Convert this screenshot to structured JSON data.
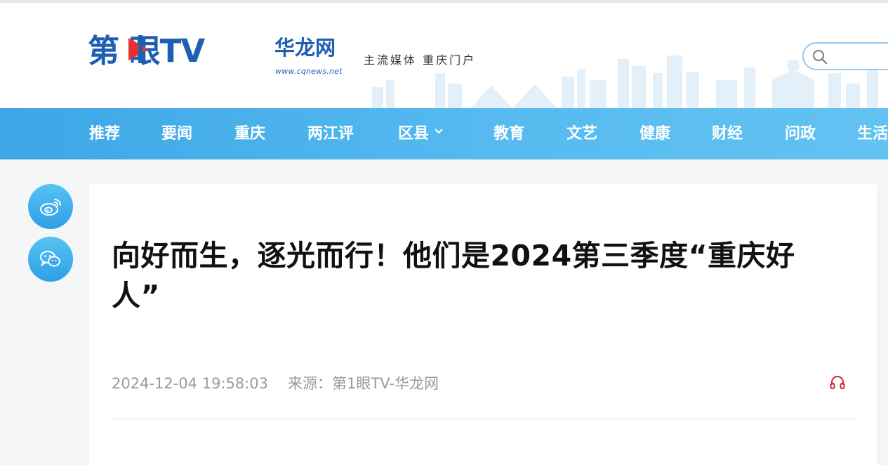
{
  "header": {
    "logo_main": "第 眼TV",
    "logo_brand": "华龙网",
    "logo_url": "www.cqnews.net",
    "slogan": "主流媒体  重庆门户",
    "search_placeholder": ""
  },
  "nav": {
    "items": [
      {
        "label": "推荐"
      },
      {
        "label": "要闻"
      },
      {
        "label": "重庆"
      },
      {
        "label": "两江评"
      },
      {
        "label": "区县",
        "has_dropdown": true
      },
      {
        "label": "教育"
      },
      {
        "label": "文艺"
      },
      {
        "label": "健康"
      },
      {
        "label": "财经"
      },
      {
        "label": "问政"
      },
      {
        "label": "生活"
      }
    ]
  },
  "share": {
    "items": [
      {
        "icon": "weibo-icon"
      },
      {
        "icon": "wechat-icon"
      }
    ]
  },
  "article": {
    "title": "向好而生，逐光而行！他们是2024第三季度“重庆好人”",
    "datetime": "2024-12-04 19:58:03",
    "source_label": "来源：",
    "source": "第1眼TV-华龙网",
    "listen_icon": "headphones-icon"
  },
  "colors": {
    "brand_blue": "#1f5fb3",
    "nav_blue": "#3ca6e6",
    "accent_red": "#d0262b"
  }
}
